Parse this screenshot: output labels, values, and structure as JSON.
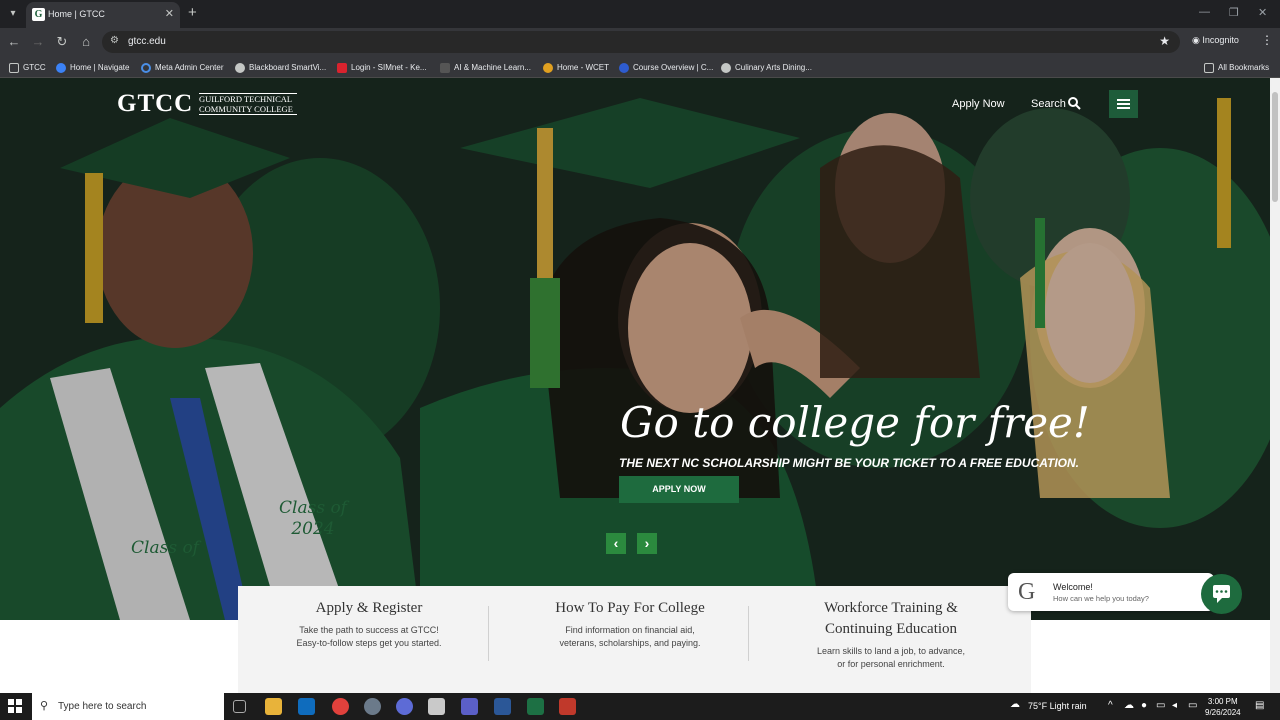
{
  "browser": {
    "tab_title": "Home | GTCC",
    "tab_favicon_letter": "G",
    "url": "gtcc.edu",
    "mode": "Incognito",
    "bookmarks": [
      "GTCC",
      "Home | Navigate",
      "Meta Admin Center",
      "Blackboard SmartVi...",
      "Login - SIMnet - Ke...",
      "AI & Machine Learn...",
      "Home - WCET",
      "Course Overview | C...",
      "Culinary Arts Dining..."
    ],
    "all_bookmarks": "All Bookmarks"
  },
  "site": {
    "logo_big": "GTCC",
    "logo_line1": "GUILFORD TECHNICAL",
    "logo_line2": "COMMUNITY COLLEGE",
    "nav_apply": "Apply Now",
    "nav_search": "Search",
    "hero_headline": "Go to college for free!",
    "hero_subline": "THE NEXT NC SCHOLARSHIP MIGHT BE YOUR TICKET TO A FREE EDUCATION.",
    "hero_cta": "APPLY NOW",
    "cards": [
      {
        "title": "Apply & Register",
        "line1": "Take the path to success at GTCC!",
        "line2": "Easy-to-follow steps get you started."
      },
      {
        "title": "How To Pay For College",
        "line1": "Find information on financial aid,",
        "line2": "veterans, scholarships, and paying."
      },
      {
        "title_line1": "Workforce Training &",
        "title_line2": "Continuing Education",
        "line1": "Learn skills to land a job, to advance,",
        "line2": "or for personal enrichment."
      }
    ],
    "chat_title": "Welcome!",
    "chat_sub": "How can we help you today?",
    "chat_logo": "G"
  },
  "taskbar": {
    "search_placeholder": "Type here to search",
    "weather": "75°F  Light rain",
    "time": "3:00 PM",
    "date": "9/26/2024"
  },
  "colors": {
    "brand_green": "#1e6b3e",
    "arrow_green": "#2b8a3e",
    "browser_bg": "#202124"
  },
  "photo_text": {
    "stole_left": "Class of 2024",
    "stole_right": "Class of"
  }
}
